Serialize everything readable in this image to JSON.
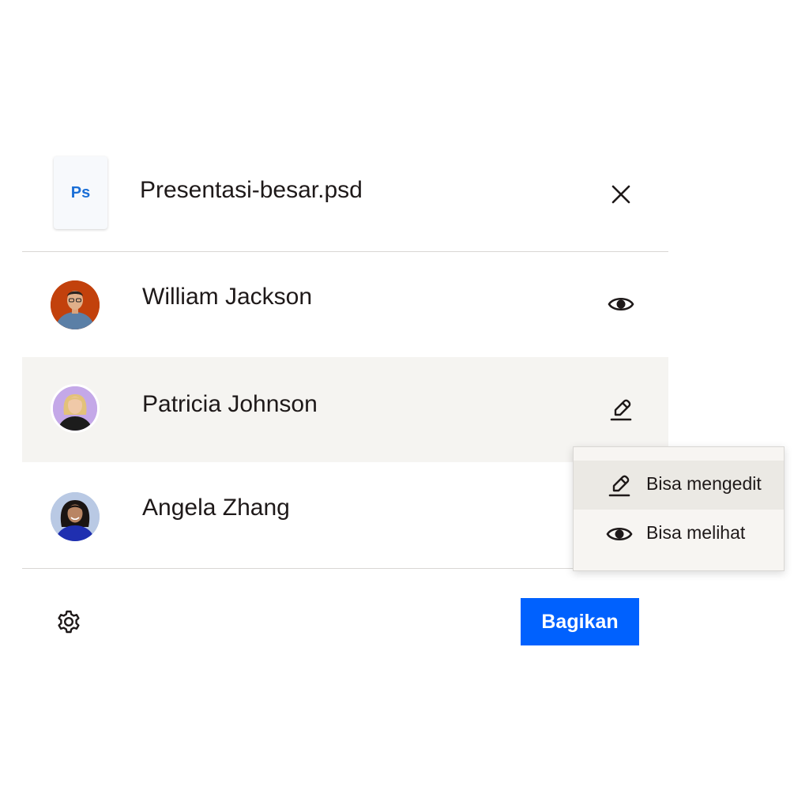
{
  "file": {
    "type_label": "Ps",
    "name": "Presentasi-besar.psd",
    "close_icon": "close-icon"
  },
  "people": [
    {
      "name": "William Jackson",
      "permission_icon": "eye-icon",
      "avatar_color": "#c2410c"
    },
    {
      "name": "Patricia Johnson",
      "permission_icon": "pencil-icon",
      "avatar_color": "#c4a8e8"
    },
    {
      "name": "Angela Zhang",
      "permission_icon": "none",
      "avatar_color": "#b9c9e4"
    }
  ],
  "permission_menu": {
    "items": [
      {
        "label": "Bisa mengedit",
        "icon": "pencil-icon",
        "selected": true
      },
      {
        "label": "Bisa melihat",
        "icon": "eye-icon",
        "selected": false
      }
    ]
  },
  "footer": {
    "settings_icon": "gear-icon",
    "share_label": "Bagikan"
  },
  "colors": {
    "primary": "#0061fe",
    "row_highlight": "#f5f4f1",
    "ps_blue": "#1b6fd6"
  }
}
